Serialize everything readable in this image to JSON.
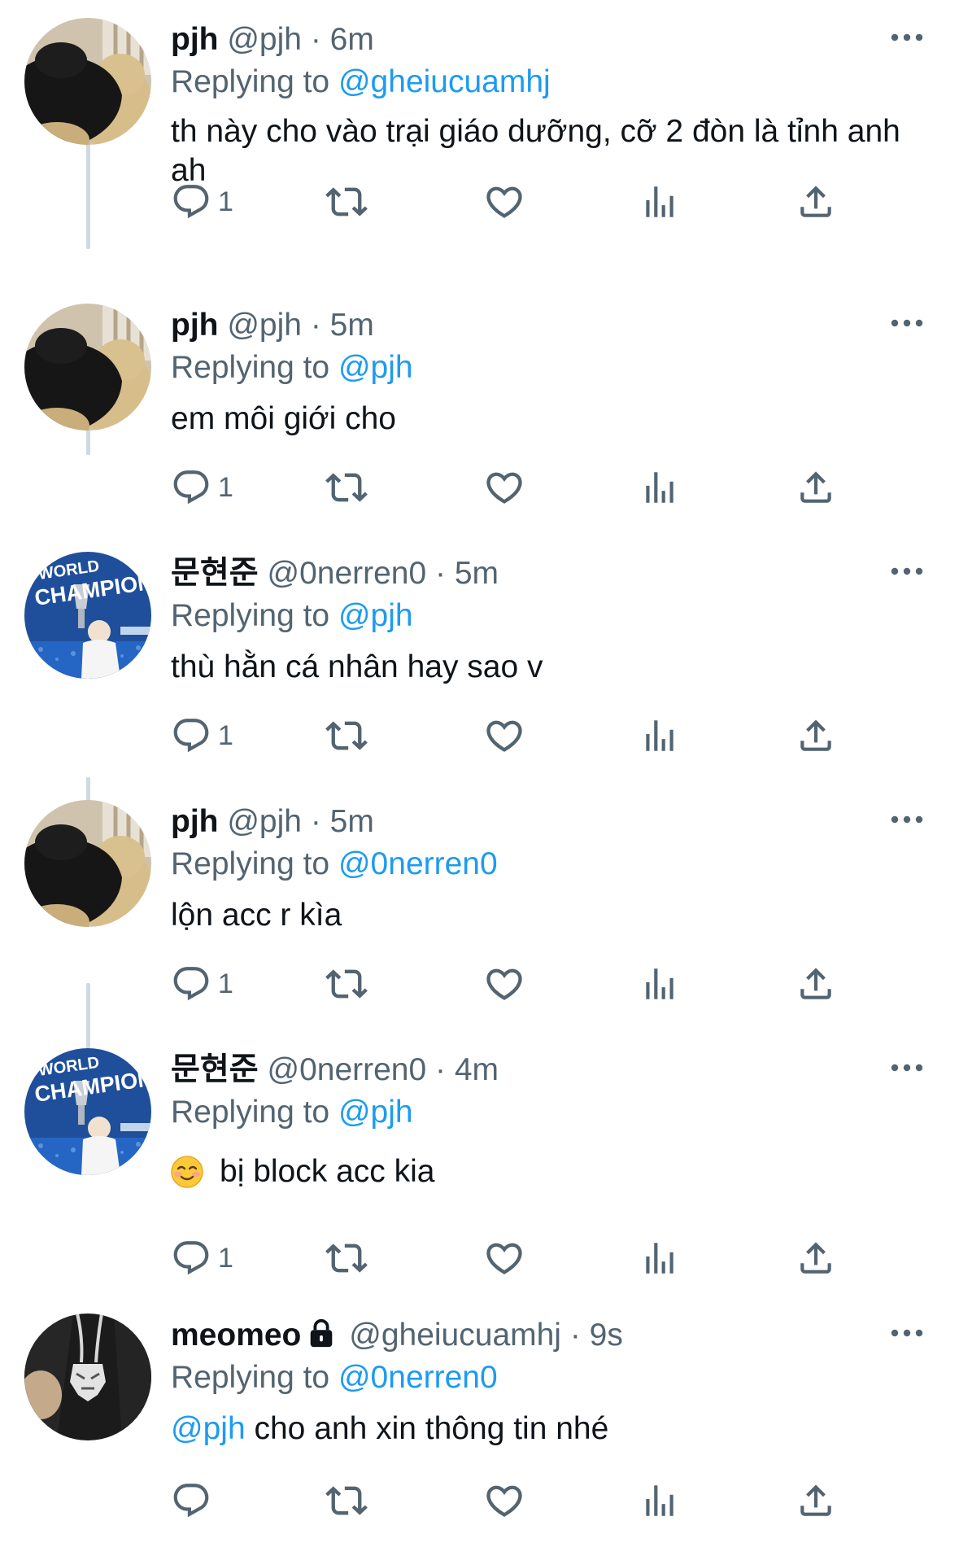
{
  "colors": {
    "accent": "#1d9bf0",
    "text_primary": "#0f1419",
    "text_secondary": "#536471",
    "thread_line": "#cfd9de"
  },
  "replying_prefix": "Replying to",
  "tweets": [
    {
      "name": "pjh",
      "handle": "@pjh",
      "time": "· 6m",
      "avatar": "teddy-bear-avatar",
      "replying_to": "@gheiucuamhj",
      "text": "th này cho vào trại giáo dưỡng, cỡ 2 đòn là tỉnh anh ah",
      "reply_count": "1"
    },
    {
      "name": "pjh",
      "handle": "@pjh",
      "time": "· 5m",
      "avatar": "teddy-bear-avatar",
      "replying_to": "@pjh",
      "text": "em môi giới cho",
      "reply_count": "1"
    },
    {
      "name": "문현준",
      "handle": "@0nerren0",
      "time": "· 5m",
      "avatar": "world-champions-avatar",
      "replying_to": "@pjh",
      "text": "thù hằn cá nhân hay sao v",
      "reply_count": "1"
    },
    {
      "name": "pjh",
      "handle": "@pjh",
      "time": "· 5m",
      "avatar": "teddy-bear-avatar",
      "replying_to": "@0nerren0",
      "text": "lộn acc r kìa",
      "reply_count": "1"
    },
    {
      "name": "문현준",
      "handle": "@0nerren0",
      "time": "· 4m",
      "avatar": "world-champions-avatar",
      "replying_to": "@pjh",
      "emoji": "smiling-face-emoji",
      "text": "bị block acc kia",
      "reply_count": "1"
    },
    {
      "name": "meomeo",
      "locked": true,
      "handle": "@gheiucuamhj",
      "time": "· 9s",
      "avatar": "tiger-pendant-avatar",
      "replying_to": "@0nerren0",
      "text_mention": "@pjh",
      "text": " cho anh xin thông tin nhé",
      "reply_count": ""
    }
  ],
  "avatar_labels": {
    "world_line1": "WORLD",
    "world_line2": "CHAMPIONS"
  }
}
